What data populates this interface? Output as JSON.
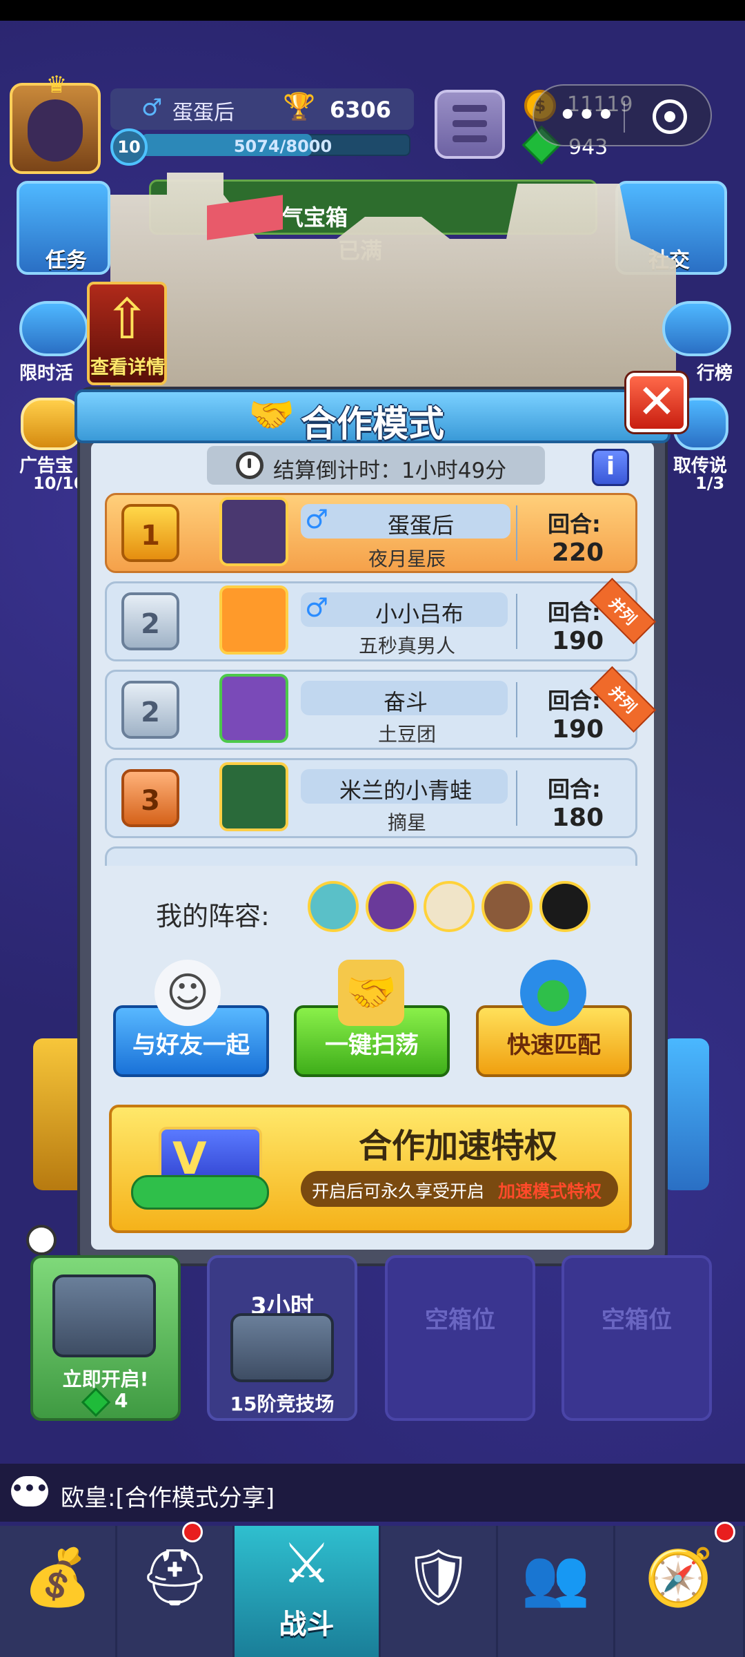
{
  "header": {
    "player_name": "蛋蛋后",
    "trophies": "6306",
    "level": "10",
    "xp": "5074/8000",
    "xp_fraction": 0.634,
    "coins": "11119",
    "gems": "943"
  },
  "side": {
    "task_label": "任务",
    "social_label": "社交",
    "limited_label": "限时活",
    "leaderboard_label": "行榜",
    "ad_label": "广告宝",
    "ad_count": "10/10",
    "legend_label": "取传说",
    "legend_count": "1/3",
    "view_detail": "查看详情"
  },
  "chest_bar": {
    "title": "勇气宝箱",
    "status": "已满"
  },
  "modal": {
    "title": "合作模式",
    "timer": "结算倒计时：1小时49分",
    "info": "i",
    "close": "✕",
    "rows": [
      {
        "rank": "1",
        "name": "蛋蛋后",
        "team": "夜月星辰",
        "round_label": "回合:",
        "rounds": "220",
        "gender": "♂",
        "tie": ""
      },
      {
        "rank": "2",
        "name": "小小吕布",
        "team": "五秒真男人",
        "round_label": "回合:",
        "rounds": "190",
        "gender": "♂",
        "tie": "并列"
      },
      {
        "rank": "2",
        "name": "奋斗",
        "team": "土豆团",
        "round_label": "回合:",
        "rounds": "190",
        "gender": "",
        "tie": "并列"
      },
      {
        "rank": "3",
        "name": "米兰的小青蛙",
        "team": "摘星",
        "round_label": "回合:",
        "rounds": "180",
        "gender": "",
        "tie": ""
      }
    ],
    "lineup_label": "我的阵容:",
    "buttons": {
      "friends": "与好友一起",
      "sweep": "一键扫荡",
      "match": "快速匹配"
    },
    "vip": {
      "title": "合作加速特权",
      "desc": "开启后可永久享受开启",
      "highlight": "加速模式特权"
    }
  },
  "chests": {
    "open_label": "立即开启!",
    "open_cost": "4",
    "timed_header": "3小时",
    "timed_label": "15阶竞技场",
    "empty1": "空箱位",
    "empty2": "空箱位"
  },
  "chat": {
    "message": "欧皇:[合作模式分享]"
  },
  "nav": {
    "battle": "战斗"
  },
  "colors": {
    "accent_blue": "#3a9ad8",
    "first_row": "#f5a14a",
    "friends_btn": "#2a8ce8",
    "sweep_btn": "#5acb2a",
    "match_btn": "#f5b21a"
  },
  "icons": [
    "crown-icon",
    "trophy-icon",
    "coin-icon",
    "gem-icon",
    "menu-icon",
    "clock-icon",
    "handshake-icon",
    "close-icon",
    "info-icon",
    "male-icon",
    "ghost-icon",
    "ticket-icon",
    "globe-icon",
    "chat-icon",
    "treasure-icon",
    "knight-icon",
    "swords-icon",
    "shield-icon",
    "team-icon",
    "compass-icon"
  ]
}
